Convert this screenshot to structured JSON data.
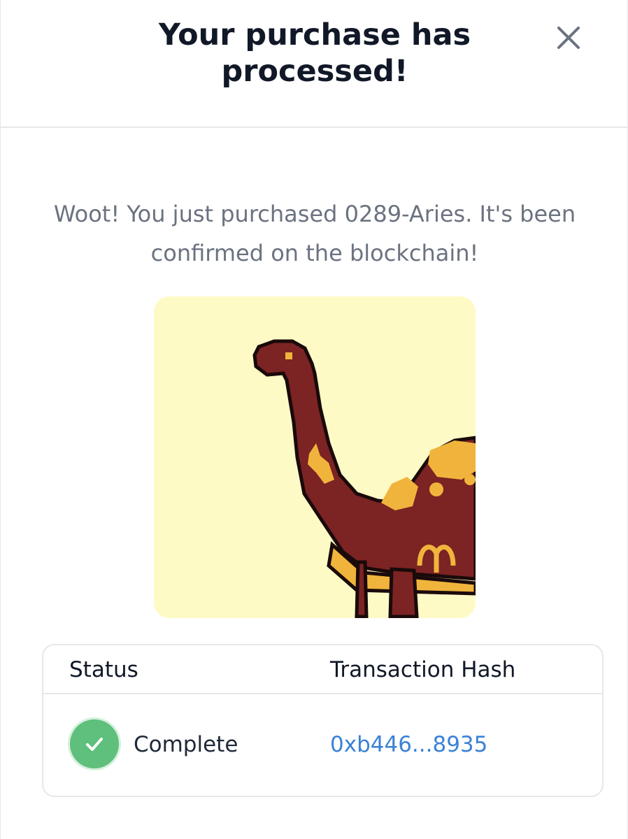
{
  "modal": {
    "title": "Your purchase has processed!",
    "close_icon": "close-icon",
    "message": "Woot! You just purchased 0289-Aries. It's been confirmed on the blockchain!"
  },
  "nft_image": {
    "subject": "pixel-art dinosaur",
    "background_color": "#fefac6",
    "body_color": "#7c2323",
    "spot_color": "#f0b43c",
    "outline_color": "#1a0a0a"
  },
  "transaction_table": {
    "headers": {
      "status": "Status",
      "hash": "Transaction Hash"
    },
    "row": {
      "status_icon": "check-circle-icon",
      "status": "Complete",
      "hash": "0xb446...8935"
    },
    "status_color": "#5fbf7c",
    "link_color": "#3b82d6"
  }
}
